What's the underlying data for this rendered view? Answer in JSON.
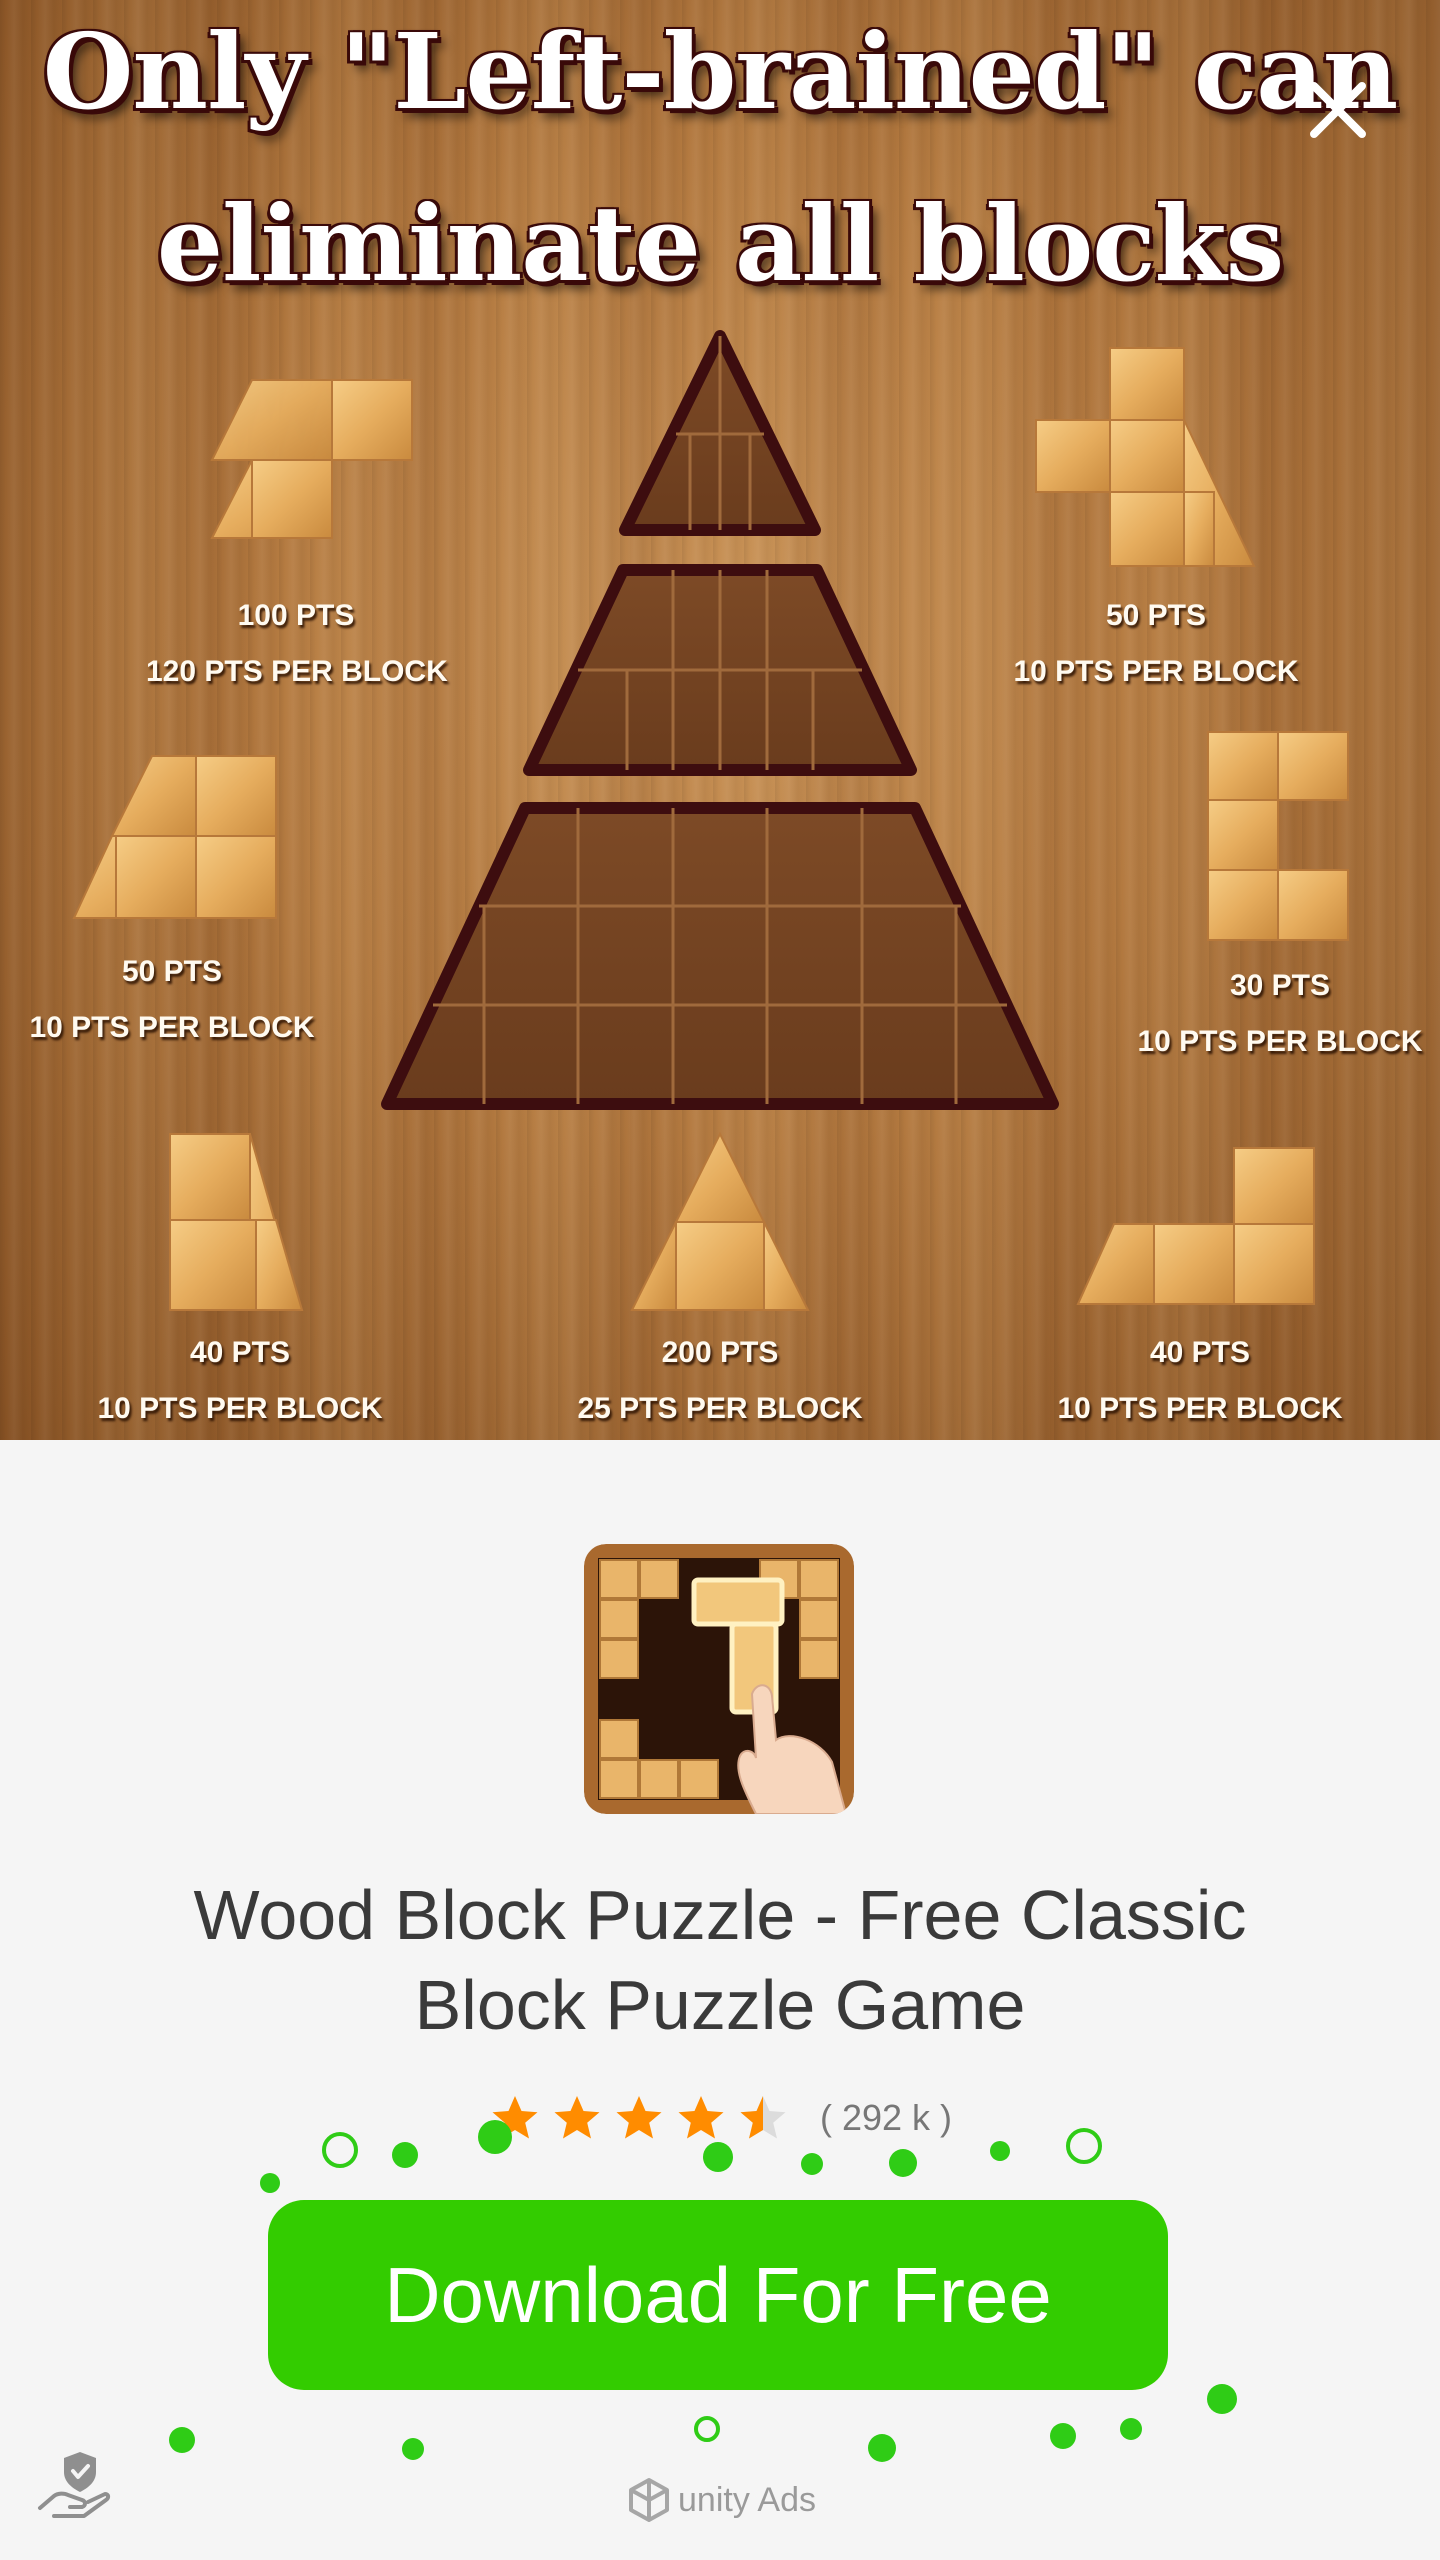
{
  "banner": {
    "headline_line1": "Only \"Left-brained\" can",
    "headline_line2": "eliminate all blocks",
    "pieces": [
      {
        "pts": "100 PTS",
        "per_block": "120 PTS PER BLOCK"
      },
      {
        "pts": "50 PTS",
        "per_block": "10 PTS PER BLOCK"
      },
      {
        "pts": "50 PTS",
        "per_block": "10 PTS PER BLOCK"
      },
      {
        "pts": "30 PTS",
        "per_block": "10 PTS PER BLOCK"
      },
      {
        "pts": "40 PTS",
        "per_block": "10 PTS PER BLOCK"
      },
      {
        "pts": "200 PTS",
        "per_block": "25 PTS PER BLOCK"
      },
      {
        "pts": "40 PTS",
        "per_block": "10 PTS PER BLOCK"
      }
    ],
    "close_icon": "close-icon"
  },
  "app": {
    "icon": "wood-block-puzzle-app-icon",
    "title_line1": "Wood Block Puzzle - Free Classic",
    "title_line2": "Block Puzzle Game",
    "rating_stars": 4.5,
    "rating_max": 5,
    "rating_count": "( 292 k )",
    "star_color": "#ff8c00",
    "download_label": "Download For Free",
    "download_color": "#33cc00"
  },
  "footer": {
    "privacy_icon": "privacy-hand-shield-icon",
    "brand_text": "unity Ads",
    "brand_icon": "unity-logo-icon"
  }
}
